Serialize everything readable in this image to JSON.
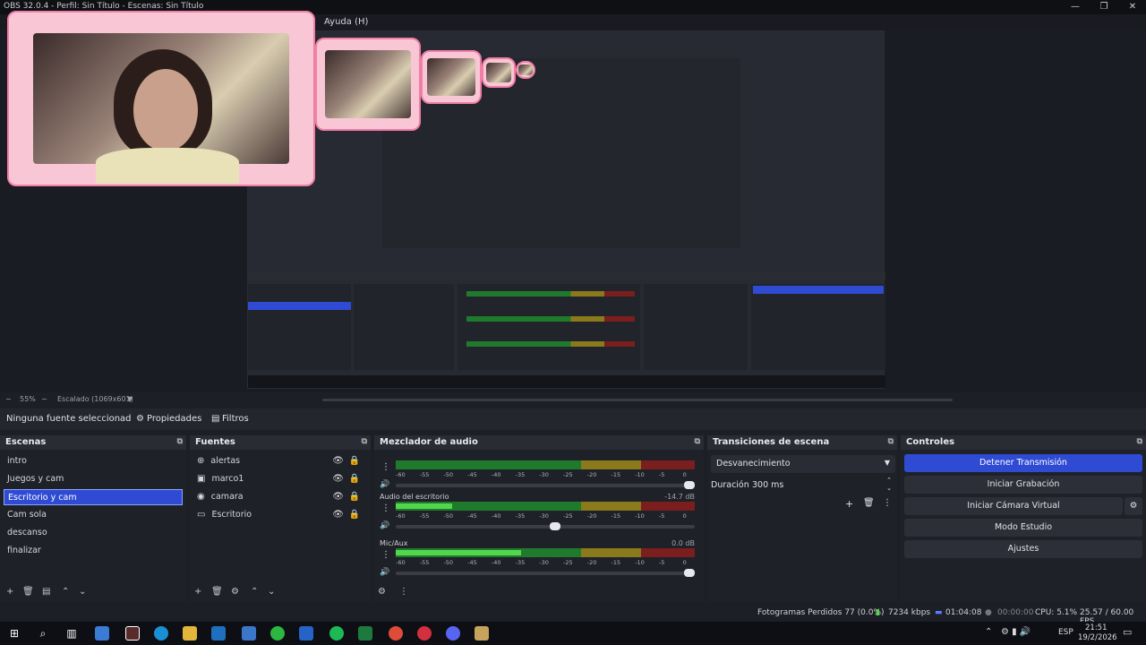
{
  "window": {
    "title": "OBS 32.0.4 - Perfil: Sin Título - Escenas: Sin Título",
    "minimize": "—",
    "restore": "❐",
    "close": "✕"
  },
  "menu": {
    "help": "Ayuda (H)"
  },
  "preview": {
    "zoom": "55%",
    "scaling": "Escalado (1069x601)"
  },
  "source_toolbar": {
    "no_source": "Ninguna fuente seleccionad",
    "properties": "Propiedades",
    "filters": "Filtros"
  },
  "scenes": {
    "title": "Escenas",
    "items": [
      "intro",
      "Juegos y cam",
      "Escritorio y cam",
      "Cam sola",
      "descanso",
      "finalizar"
    ],
    "selected_index": 2
  },
  "sources": {
    "title": "Fuentes",
    "items": [
      {
        "label": "alertas",
        "icon": "browser-icon"
      },
      {
        "label": "marco1",
        "icon": "image-icon"
      },
      {
        "label": "camara",
        "icon": "camera-icon"
      },
      {
        "label": "Escritorio",
        "icon": "monitor-icon"
      }
    ]
  },
  "mixer": {
    "title": "Mezclador de audio",
    "ticks": [
      "-60",
      "-55",
      "-50",
      "-45",
      "-40",
      "-35",
      "-30",
      "-25",
      "-20",
      "-15",
      "-10",
      "-5",
      "0"
    ],
    "channels": [
      {
        "name": "",
        "db": "",
        "level": 0.0,
        "volume": 1.0
      },
      {
        "name": "Audio del escritorio",
        "db": "-14.7 dB",
        "level": 0.19,
        "volume": 0.55
      },
      {
        "name": "Mic/Aux",
        "db": "0.0 dB",
        "level": 0.42,
        "volume": 1.0
      }
    ]
  },
  "transitions": {
    "title": "Transiciones de escena",
    "selected": "Desvanecimiento",
    "duration_label": "Duración",
    "duration_value": "300 ms"
  },
  "controls": {
    "title": "Controles",
    "stop_stream": "Detener Transmisión",
    "start_recording": "Iniciar Grabación",
    "start_virtual_cam": "Iniciar Cámara Virtual",
    "studio_mode": "Modo Estudio",
    "settings": "Ajustes"
  },
  "status": {
    "dropped_frames": "Fotogramas Perdidos 77 (0.0%)",
    "bitrate": "7234 kbps",
    "stream_time": "01:04:08",
    "record_time": "00:00:00",
    "cpu": "CPU: 5.1%",
    "fps": "25.57 / 60.00 FPS"
  },
  "taskbar": {
    "language": "ESP",
    "time": "21:51",
    "date": "19/2/2026"
  },
  "colors": {
    "accent": "#2f4bd3",
    "panel": "#1f2128",
    "meter_green": "#1f7a2c",
    "meter_yellow": "#8a7a1c",
    "meter_red": "#7a1e1e",
    "frame_pink": "#f9c6d6"
  }
}
